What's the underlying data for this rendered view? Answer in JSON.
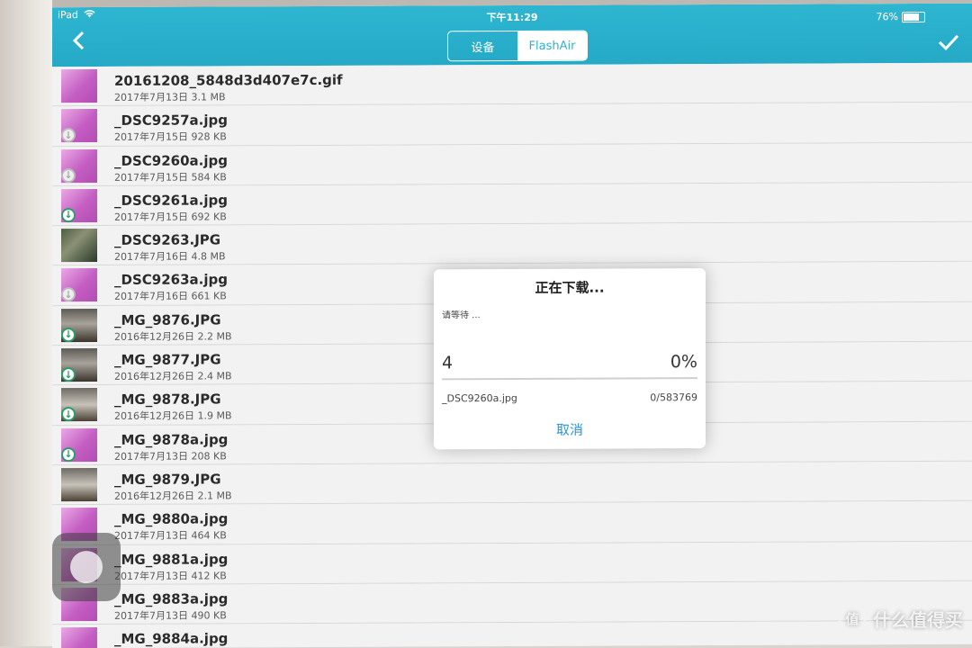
{
  "status_bar": {
    "device": "iPad",
    "time": "下午11:29",
    "battery": "76%"
  },
  "nav": {
    "back_icon": "chevron-left-icon",
    "segments": [
      {
        "label": "设备",
        "selected": false
      },
      {
        "label": "FlashAir",
        "selected": true
      }
    ],
    "confirm_icon": "checkmark-icon",
    "accent_color": "#2eb1cd"
  },
  "files": [
    {
      "name": "20161208_5848d3d407e7c.gif",
      "meta": "2017年7月13日 3.1 MB",
      "thumb": "pink",
      "download": "none"
    },
    {
      "name": "_DSC9257a.jpg",
      "meta": "2017年7月15日 928 KB",
      "thumb": "pink",
      "download": "grey"
    },
    {
      "name": "_DSC9260a.jpg",
      "meta": "2017年7月15日 584 KB",
      "thumb": "pink",
      "download": "grey"
    },
    {
      "name": "_DSC9261a.jpg",
      "meta": "2017年7月15日 692 KB",
      "thumb": "pink",
      "download": "green"
    },
    {
      "name": "_DSC9263.JPG",
      "meta": "2017年7月16日 4.8 MB",
      "thumb": "photo-a",
      "download": "none"
    },
    {
      "name": "_DSC9263a.jpg",
      "meta": "2017年7月16日 661 KB",
      "thumb": "pink",
      "download": "grey"
    },
    {
      "name": "_MG_9876.JPG",
      "meta": "2016年12月26日 2.2 MB",
      "thumb": "photo-b",
      "download": "green"
    },
    {
      "name": "_MG_9877.JPG",
      "meta": "2016年12月26日 2.4 MB",
      "thumb": "photo-b",
      "download": "green"
    },
    {
      "name": "_MG_9878.JPG",
      "meta": "2016年12月26日 1.9 MB",
      "thumb": "photo-c",
      "download": "green"
    },
    {
      "name": "_MG_9878a.jpg",
      "meta": "2017年7月13日 208 KB",
      "thumb": "pink",
      "download": "green"
    },
    {
      "name": "_MG_9879.JPG",
      "meta": "2016年12月26日 2.1 MB",
      "thumb": "photo-c",
      "download": "none"
    },
    {
      "name": "_MG_9880a.jpg",
      "meta": "2017年7月13日 464 KB",
      "thumb": "pink",
      "download": "none"
    },
    {
      "name": "_MG_9881a.jpg",
      "meta": "2017年7月13日 412 KB",
      "thumb": "pink",
      "download": "none"
    },
    {
      "name": "_MG_9883a.jpg",
      "meta": "2017年7月13日 490 KB",
      "thumb": "pink",
      "download": "none"
    },
    {
      "name": "_MG_9884a.jpg",
      "meta": "",
      "thumb": "pink",
      "download": "none"
    }
  ],
  "dialog": {
    "title": "正在下载...",
    "message": "请等待 ...",
    "count": "4",
    "percent": "0%",
    "progress": 0,
    "filename": "_DSC9260a.jpg",
    "bytes": "0/583769",
    "cancel": "取消"
  },
  "watermark": {
    "logo": "值",
    "text": "什么值得买"
  }
}
